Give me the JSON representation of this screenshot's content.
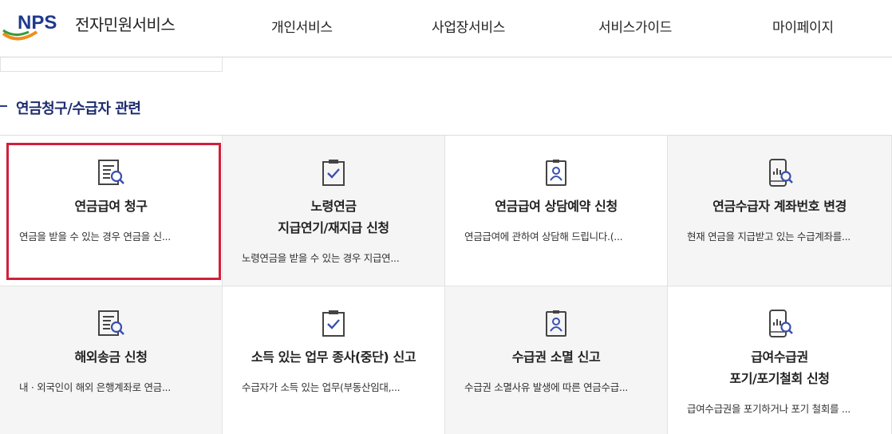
{
  "header": {
    "logo_mark": "NPS",
    "logo_text": "전자민원서비스",
    "nav": [
      "개인서비스",
      "사업장서비스",
      "서비스가이드",
      "마이페이지"
    ]
  },
  "section": {
    "title": "연금청구/수급자 관련"
  },
  "cards": [
    {
      "title1": "연금급여 청구",
      "title2": "",
      "desc": "연금을 받을 수 있는 경우 연금을 신...",
      "icon": "document-search-icon"
    },
    {
      "title1": "노령연금",
      "title2": "지급연기/재지급 신청",
      "desc": "노령연금을 받을 수 있는 경우 지급연...",
      "icon": "clipboard-check-icon"
    },
    {
      "title1": "연금급여 상담예약 신청",
      "title2": "",
      "desc": "연금급여에 관하여 상담해 드립니다.(...",
      "icon": "person-badge-icon"
    },
    {
      "title1": "연금수급자 계좌번호 변경",
      "title2": "",
      "desc": "현재 연금을 지급받고 있는 수급계좌를...",
      "icon": "mobile-search-icon"
    },
    {
      "title1": "해외송금 신청",
      "title2": "",
      "desc": "내 · 외국인이 해외 은행계좌로 연금...",
      "icon": "document-search-icon"
    },
    {
      "title1": "소득 있는 업무 종사(중단) 신고",
      "title2": "",
      "desc": "수급자가 소득 있는 업무(부동산임대,...",
      "icon": "clipboard-check-icon"
    },
    {
      "title1": "수급권 소멸 신고",
      "title2": "",
      "desc": "수급권 소멸사유 발생에 따른 연금수급...",
      "icon": "person-badge-icon"
    },
    {
      "title1": "급여수급권",
      "title2": "포기/포기철회 신청",
      "desc": "급여수급권을 포기하거나 포기 철회를 ...",
      "icon": "mobile-search-icon"
    }
  ],
  "colors": {
    "accent": "#1e2c6e",
    "selected_border": "#d0203b",
    "icon_dark": "#444444",
    "icon_blue": "#3a4fb0"
  }
}
